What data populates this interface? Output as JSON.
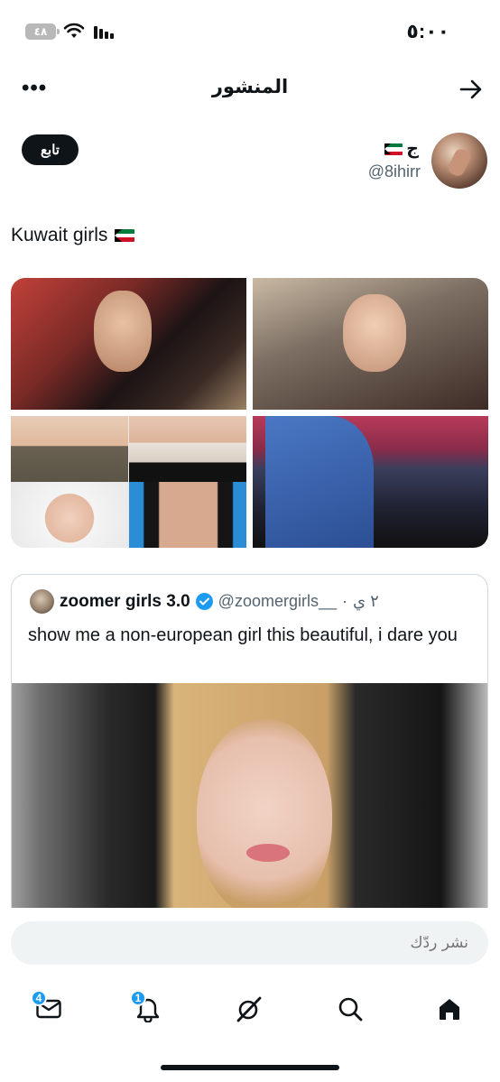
{
  "status_bar": {
    "time": "٥:٠٠",
    "battery": "٤٨"
  },
  "header": {
    "title": "المنشور",
    "more_icon": "more-horizontal-icon",
    "back_icon": "arrow-right-icon"
  },
  "author": {
    "display_name": "ج",
    "handle": "@8ihirr",
    "follow_label": "تابع"
  },
  "post": {
    "text": "Kuwait girls",
    "flag": "kuwait-flag"
  },
  "quote": {
    "name": "zoomer girls 3.0",
    "handle": "@zoomergirls__",
    "dot": "·",
    "time": "٢ ي",
    "text": "show me a non-european girl this beautiful, i dare you"
  },
  "reply": {
    "placeholder": "نشر ردّك"
  },
  "bottom_nav": {
    "messages_badge": "4",
    "notifications_badge": "1"
  },
  "colors": {
    "accent": "#1d9bf0",
    "text": "#0f1419",
    "secondary_text": "#536471"
  }
}
